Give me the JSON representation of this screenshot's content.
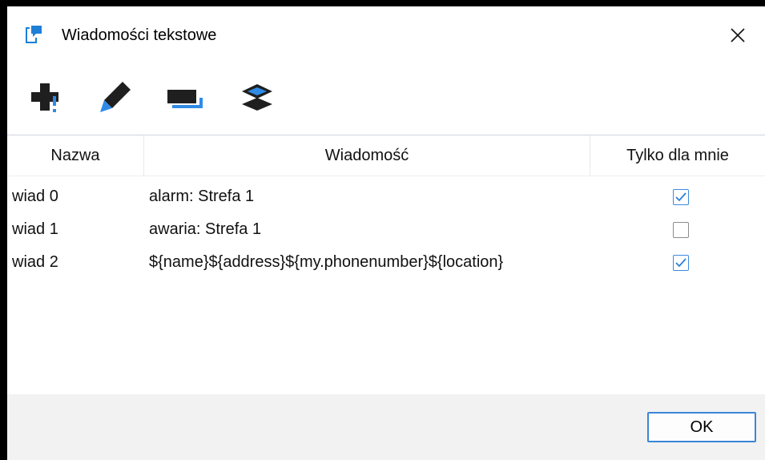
{
  "window": {
    "title": "Wiadomości tekstowe"
  },
  "toolbar": {
    "buttons": [
      {
        "icon": "add-icon"
      },
      {
        "icon": "pencil-edit-icon"
      },
      {
        "icon": "move-icon"
      },
      {
        "icon": "layers-icon"
      }
    ]
  },
  "table": {
    "columns": [
      "Nazwa",
      "Wiadomość",
      "Tylko dla mnie"
    ],
    "rows": [
      {
        "name": "wiad 0",
        "message": "alarm: Strefa 1",
        "only_me": true
      },
      {
        "name": "wiad 1",
        "message": "awaria: Strefa 1",
        "only_me": false
      },
      {
        "name": "wiad 2",
        "message": "${name}${address}${my.phonenumber}${location}",
        "only_me": true
      }
    ]
  },
  "footer": {
    "ok_label": "OK"
  },
  "colors": {
    "accent": "#3b86d8",
    "icon_dark": "#1f1f1f",
    "footer_bg": "#f2f2f2"
  }
}
